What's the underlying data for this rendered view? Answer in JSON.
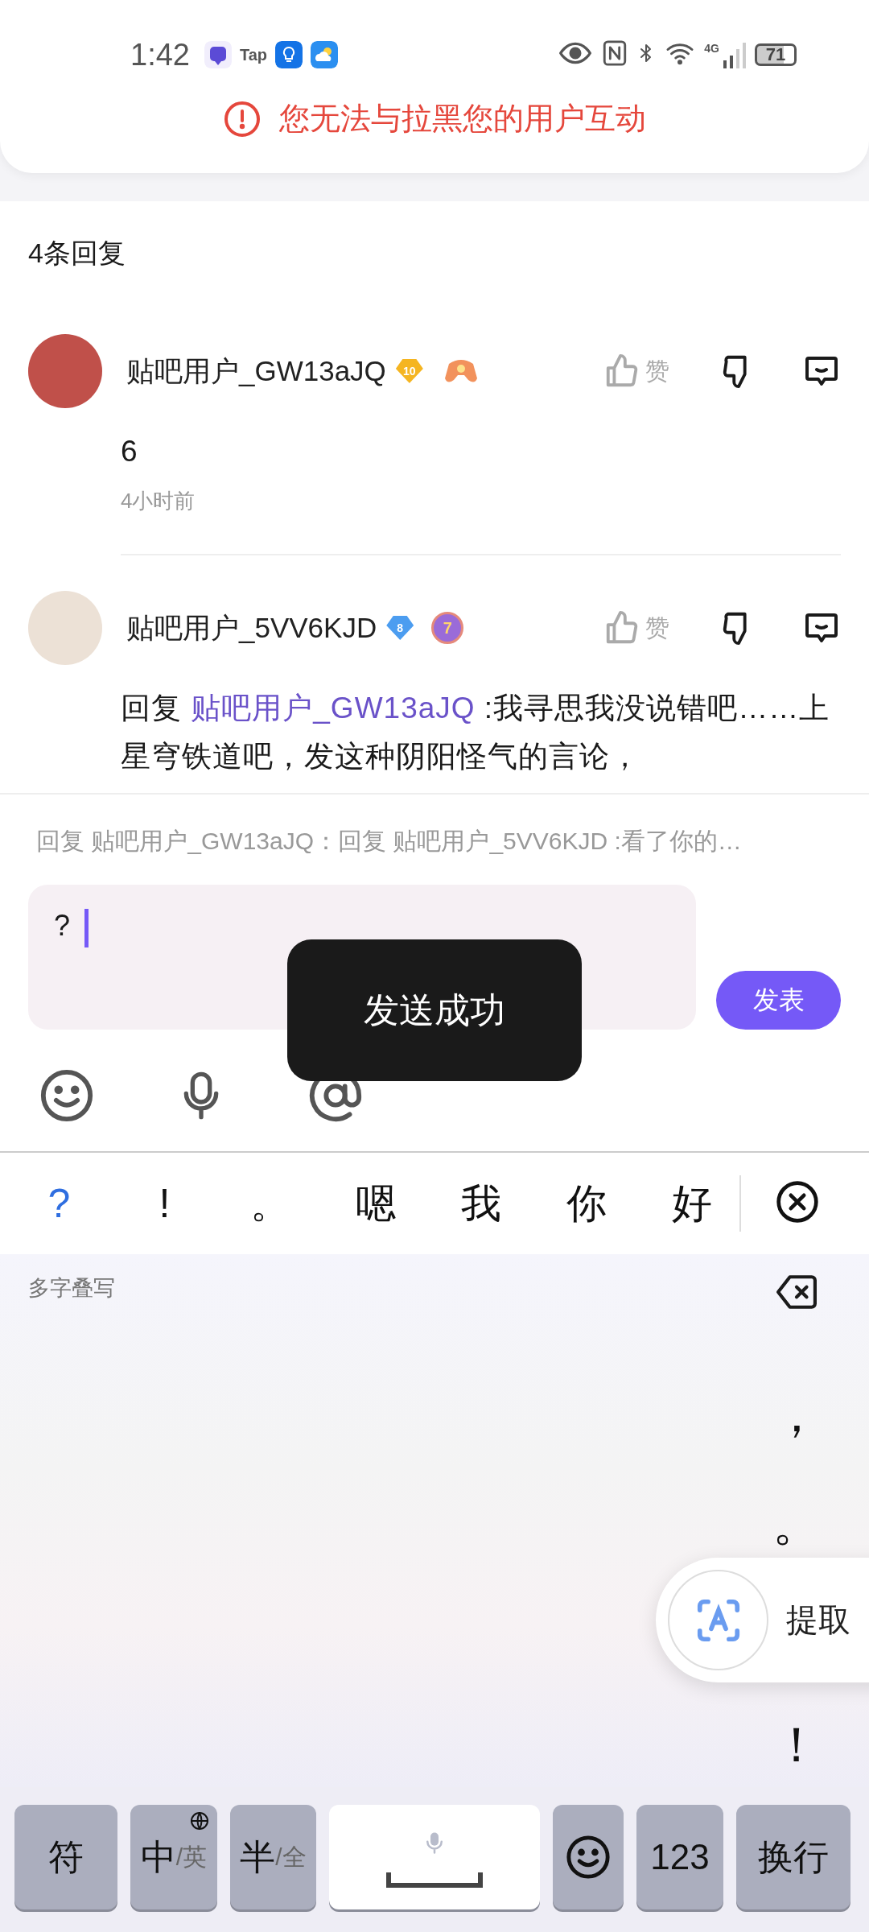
{
  "status_bar": {
    "time": "1:42",
    "app_label": "Tap",
    "network": "4G",
    "battery": "71"
  },
  "banner": {
    "text": "您无法与拉黑您的用户互动"
  },
  "reply_count": "4条回复",
  "comments": [
    {
      "username": "贴吧用户_GW13aJQ",
      "level": "10",
      "color": "#f5b521",
      "badge": {
        "kind": "controller"
      },
      "like_label": "赞",
      "text": "6",
      "time": "4小时前"
    },
    {
      "username": "贴吧用户_5VV6KJD",
      "level": "8",
      "color": "#4c9df0",
      "badge": {
        "kind": "medal",
        "label": "7"
      },
      "like_label": "赞",
      "reply_prefix": "回复",
      "reply_to": "贴吧用户_GW13aJQ",
      "text": " :我寻思我没说错吧……上星穹铁道吧，发这种阴阳怪气的言论，"
    }
  ],
  "reply_hint": "回复 贴吧用户_GW13aJQ：回复 贴吧用户_5VV6KJD :看了你的…",
  "input": {
    "value": "?"
  },
  "send_button": "发表",
  "toast": "发送成功",
  "candidates": [
    {
      "text": "?",
      "selected": true
    },
    {
      "text": "!",
      "selected": false
    },
    {
      "text": "。",
      "selected": false
    },
    {
      "text": "嗯",
      "selected": false
    },
    {
      "text": "我",
      "selected": false
    },
    {
      "text": "你",
      "selected": false
    },
    {
      "text": "好",
      "selected": false
    }
  ],
  "handwriting": {
    "mode_label": "多字叠写",
    "punctuation": [
      "，",
      "。",
      "！"
    ],
    "popup": "提取"
  },
  "keys": [
    {
      "kind": "text",
      "label": "符"
    },
    {
      "kind": "lang",
      "label": "中",
      "alt": "/英"
    },
    {
      "kind": "toggle",
      "label": "半",
      "alt": "/全"
    },
    {
      "kind": "space"
    },
    {
      "kind": "emoji"
    },
    {
      "kind": "text",
      "label": "123"
    },
    {
      "kind": "text",
      "label": "换行"
    }
  ]
}
